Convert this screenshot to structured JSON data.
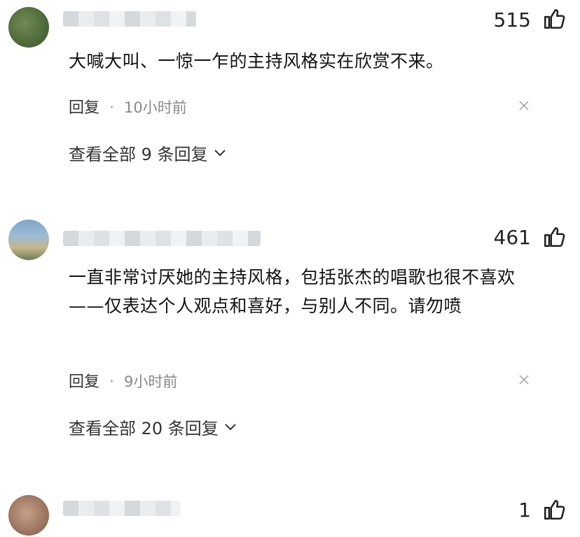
{
  "comments": [
    {
      "likes": "515",
      "text": "大喊大叫、一惊一乍的主持风格实在欣赏不来。",
      "reply_label": "回复",
      "dot": "·",
      "time": "10小时前",
      "view_all": "查看全部 9 条回复"
    },
    {
      "likes": "461",
      "text": "一直非常讨厌她的主持风格，包括张杰的唱歌也很不喜欢——仅表达个人观点和喜好，与别人不同。请勿喷",
      "reply_label": "回复",
      "dot": "·",
      "time": "9小时前",
      "view_all": "查看全部 20 条回复"
    },
    {
      "likes": "1"
    }
  ],
  "colors": {
    "text": "#111111",
    "muted": "#888888",
    "icon": "#222222"
  },
  "icons": [
    "thumbs-up-icon",
    "close-icon",
    "chevron-down-icon"
  ]
}
